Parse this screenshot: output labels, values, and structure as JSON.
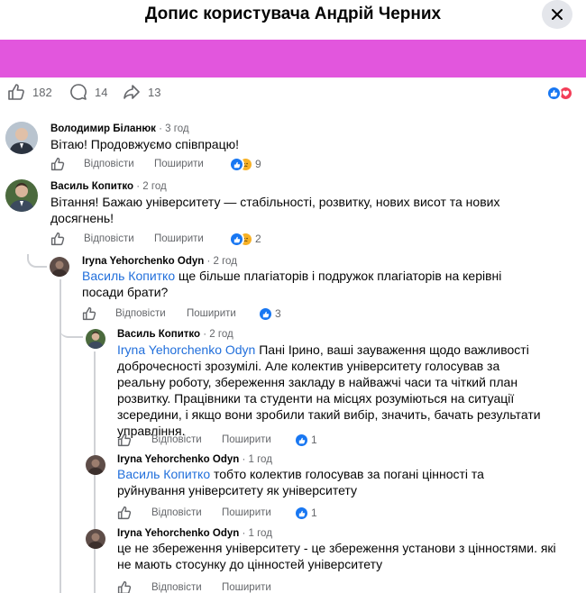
{
  "header": {
    "title": "Допис користувача Андрій Черних"
  },
  "colors": {
    "banner": "#e256dd",
    "link": "#216fdb",
    "like": "#1877f2",
    "love": "#f33e58",
    "care": "#f7b125"
  },
  "post_stats": {
    "likes": "182",
    "comments": "14",
    "shares": "13"
  },
  "labels": {
    "reply": "Відповісти",
    "share": "Поширити"
  },
  "comments": [
    {
      "author": "Володимир Біланюк",
      "time": "3 год",
      "text": "Вітаю! Продовжуємо співпрацю!",
      "reactions": "9"
    },
    {
      "author": "Василь Копитко",
      "time": "2 год",
      "text": "Вітання! Бажаю університету — стабільності, розвитку, нових висот та нових досягнень!",
      "reactions": "2"
    }
  ],
  "replies": [
    {
      "author": "Iryna Yehorchenko Odyn",
      "time": "2 год",
      "mention": "Василь Копитко",
      "text": "ще більше плагіаторів і подружок плагіаторів на керівні посади брати?",
      "reactions": "3"
    },
    {
      "author": "Василь Копитко",
      "time": "2 год",
      "mention": "Iryna Yehorchenko Odyn",
      "text": "Пані Ірино, ваші зауваження щодо важливості доброчесності зрозумілі. Але колектив університету голосував за реальну роботу, збереження закладу в найважчі часи та чіткий план розвитку. Працівники та студенти на місцях розуміються на ситуації зсередини, і якщо вони зробили такий вибір, значить, бачать результати управління.",
      "reactions": "1"
    },
    {
      "author": "Iryna Yehorchenko Odyn",
      "time": "1 год",
      "mention": "Василь Копитко",
      "text": "тобто колектив голосував за погані цінності та руйнування університету як університету",
      "reactions": "1"
    },
    {
      "author": "Iryna Yehorchenko Odyn",
      "time": "1 год",
      "mention": "",
      "text": "це не збереження університету - це збереження установи з цінностями. які не мають стосунку до цінностей університету",
      "reactions": ""
    }
  ]
}
